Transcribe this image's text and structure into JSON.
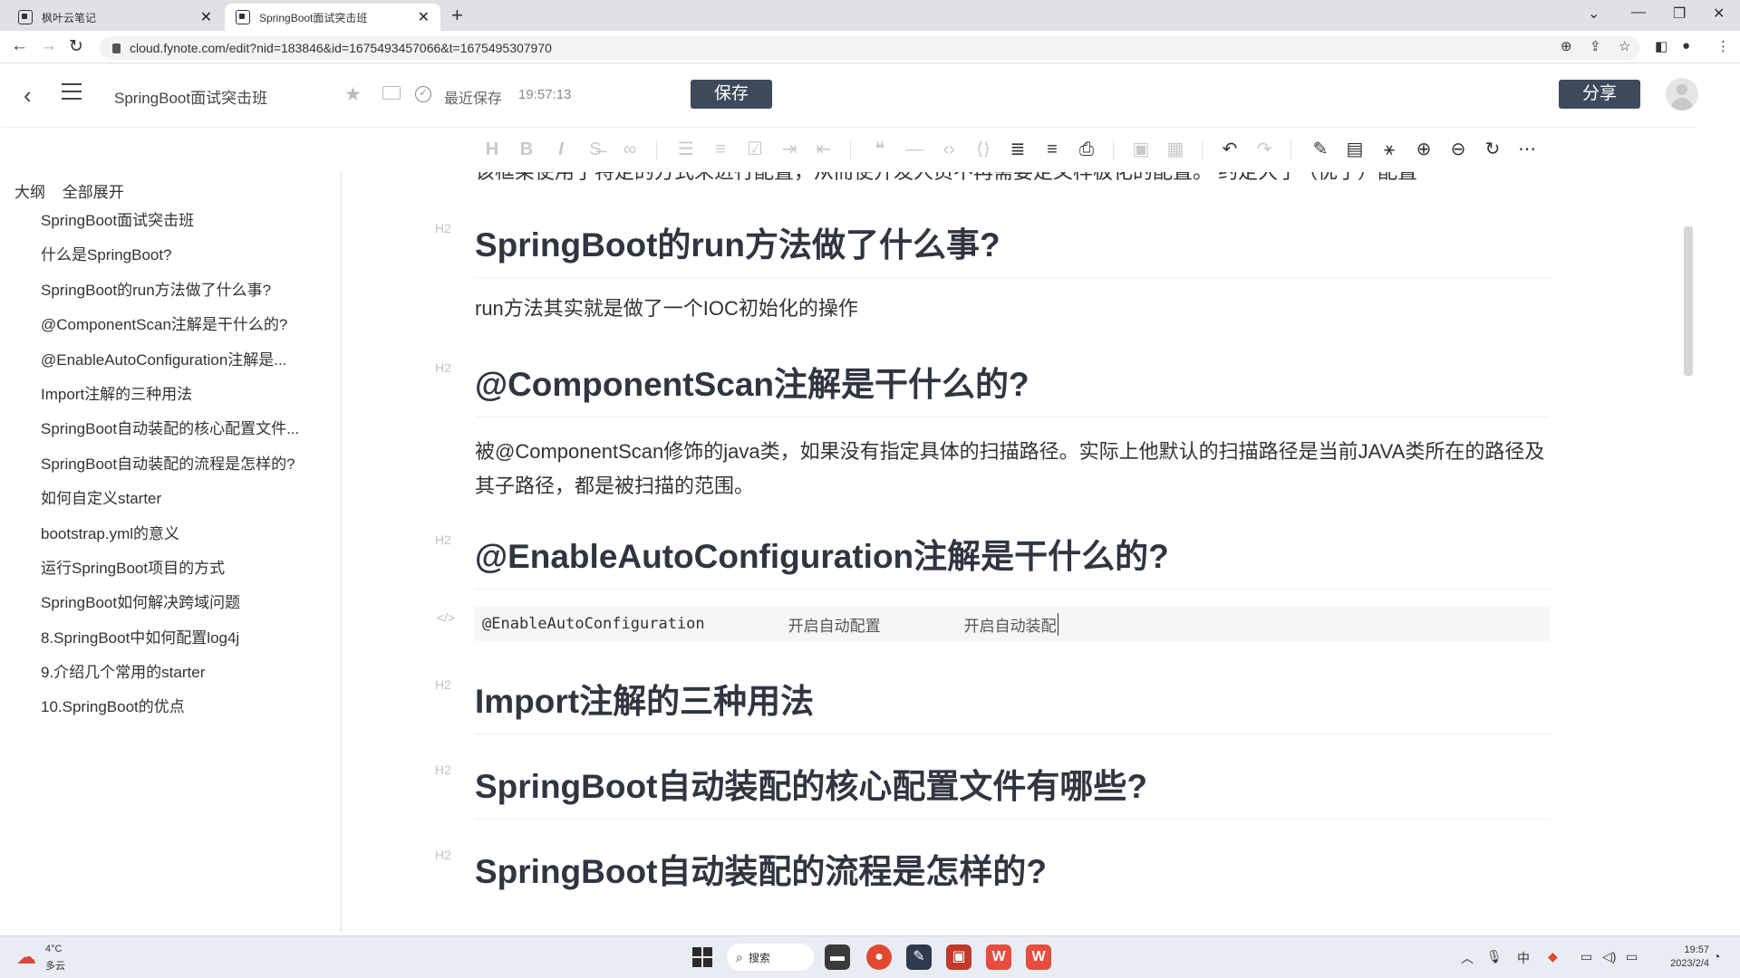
{
  "browser": {
    "tabs": [
      {
        "title": "枫叶云笔记"
      },
      {
        "title": "SpringBoot面试突击班"
      }
    ],
    "url": "cloud.fynote.com/edit?nid=183846&id=1675493457066&t=1675495307970"
  },
  "header": {
    "title": "SpringBoot面试突击班",
    "save_status": "最近保存",
    "save_time": "19:57:13",
    "save_label": "保存",
    "share_label": "分享"
  },
  "outline": {
    "label": "大纲",
    "expand_label": "全部展开",
    "items": [
      "SpringBoot面试突击班",
      "什么是SpringBoot?",
      "SpringBoot的run方法做了什么事?",
      "@ComponentScan注解是干什么的?",
      "@EnableAutoConfiguration注解是...",
      "Import注解的三种用法",
      "SpringBoot自动装配的核心配置文件...",
      "SpringBoot自动装配的流程是怎样的?",
      "如何自定义starter",
      "bootstrap.yml的意义",
      "运行SpringBoot项目的方式",
      "SpringBoot如何解决跨域问题",
      "8.SpringBoot中如何配置log4j",
      "9.介绍几个常用的starter",
      "10.SpringBoot的优点"
    ]
  },
  "content": {
    "cut_text": "该框架使用了特定的方式来进行配置，从而使开发人员不再需要定义样板化的配置。  约定大于（优于）配置",
    "h2_tag": "H2",
    "code_tag": "</>",
    "h_run": "SpringBoot的run方法做了什么事?",
    "p_run": "run方法其实就是做了一个IOC初始化的操作",
    "h_scan": "@ComponentScan注解是干什么的?",
    "p_scan": "被@ComponentScan修饰的java类，如果没有指定具体的扫描路径。实际上他默认的扫描路径是当前JAVA类所在的路径及其子路径，都是被扫描的范围。",
    "h_enable": "@EnableAutoConfiguration注解是干什么的?",
    "code_annotation": "@EnableAutoConfiguration",
    "code_comment1": "开启自动配置",
    "code_comment2": "开启自动装配",
    "h_import": "Import注解的三种用法",
    "h_core": "SpringBoot自动装配的核心配置文件有哪些?",
    "h_flow": "SpringBoot自动装配的流程是怎样的?"
  },
  "taskbar": {
    "temp": "4°C",
    "weather": "多云",
    "search_label": "搜索",
    "ime": "中",
    "time": "19:57",
    "date": "2023/2/4"
  },
  "colors": {
    "button_bg": "#3d4a5c",
    "heading": "#2f3640",
    "code_bg": "#f6f6f6"
  }
}
